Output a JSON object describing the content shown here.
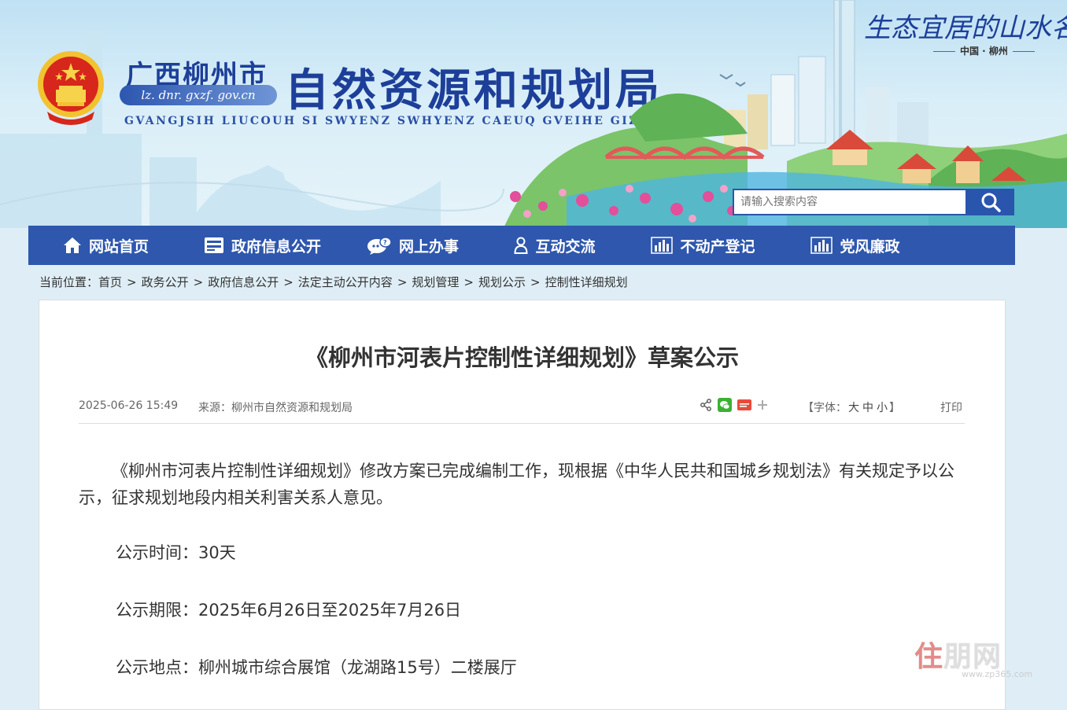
{
  "header": {
    "prov_city": "广西柳州市",
    "domain": "lz. dnr. gxzf. gov.cn",
    "bureau": "自然资源和规划局",
    "zhuang_name": "GVANGJSIH LIUCOUH SI SWYENZ SWHYENZ CAEUQ GVEIHE GIZ",
    "slogan": "生态宜居的山水名城",
    "slogan_sub": "中国 · 柳州"
  },
  "search": {
    "placeholder": "请输入搜索内容"
  },
  "nav": [
    {
      "label": "网站首页",
      "icon": "home-icon"
    },
    {
      "label": "政府信息公开",
      "icon": "info-box-icon"
    },
    {
      "label": "网上办事",
      "icon": "chat-icon"
    },
    {
      "label": "互动交流",
      "icon": "user-icon"
    },
    {
      "label": "不动产登记",
      "icon": "bar-chart-icon"
    },
    {
      "label": "党风廉政",
      "icon": "bar-chart-icon"
    }
  ],
  "breadcrumb": {
    "prefix": "当前位置：",
    "items": [
      "首页",
      "政务公开",
      "政府信息公开",
      "法定主动公开内容",
      "规划管理",
      "规划公示",
      "控制性详细规划"
    ]
  },
  "article": {
    "title": "《柳州市河表片控制性详细规划》草案公示",
    "date": "2025-06-26 15:49",
    "source": "来源：柳州市自然资源和规划局",
    "font_prefix": "【字体：",
    "font_large": "大",
    "font_medium": "中",
    "font_small": "小",
    "font_suffix": "】",
    "print": "打印",
    "paragraph": "《柳州市河表片控制性详细规划》修改方案已完成编制工作，现根据《中华人民共和国城乡规划法》有关规定予以公示，征求规划地段内相关利害关系人意见。",
    "rows": [
      "公示时间：30天",
      "公示期限：2025年6月26日至2025年7月26日",
      "公示地点：柳州城市综合展馆（龙湖路15号）二楼展厅"
    ]
  },
  "watermark": {
    "logo_a": "住",
    "logo_b": "朋网",
    "url": "www.zp365.com"
  },
  "colors": {
    "nav_bg": "#2e57ad",
    "title_blue": "#1d3f99",
    "emblem_red": "#d7261b"
  }
}
